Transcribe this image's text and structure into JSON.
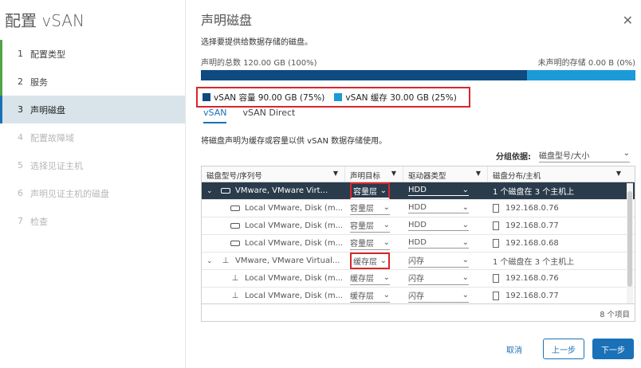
{
  "wizard": {
    "title": "配置 vSAN"
  },
  "steps": [
    {
      "num": "1",
      "label": "配置类型"
    },
    {
      "num": "2",
      "label": "服务"
    },
    {
      "num": "3",
      "label": "声明磁盘"
    },
    {
      "num": "4",
      "label": "配置故障域"
    },
    {
      "num": "5",
      "label": "选择见证主机"
    },
    {
      "num": "6",
      "label": "声明见证主机的磁盘"
    },
    {
      "num": "7",
      "label": "检查"
    }
  ],
  "page": {
    "title": "声明磁盘",
    "description": "选择要提供给数据存储的磁盘。",
    "claimed_total": "声明的总数 120.00 GB (100%)",
    "unclaimed": "未声明的存储 0.00 B (0%)",
    "capacity_fraction": 0.75,
    "legend": [
      {
        "label": "vSAN 容量 90.00 GB (75%)",
        "color": "#0f4a80"
      },
      {
        "label": "vSAN 缓存 30.00 GB (25%)",
        "color": "#1a9bd8"
      }
    ],
    "tabs": [
      "vSAN",
      "vSAN Direct"
    ],
    "instruction": "将磁盘声明为缓存或容量以供 vSAN 数据存储使用。",
    "group_by_label": "分组依据:",
    "group_by_value": "磁盘型号/大小"
  },
  "grid": {
    "headers": [
      "磁盘型号/序列号",
      "声明目标",
      "驱动器类型",
      "磁盘分布/主机"
    ],
    "rows": [
      {
        "name": "VMware, VMware Virt...",
        "target": "容量层",
        "drive": "HDD",
        "dist": "1 个磁盘在 3 个主机上"
      },
      {
        "name": "Local VMware, Disk (m...",
        "target": "容量层",
        "drive": "HDD",
        "dist": "192.168.0.76"
      },
      {
        "name": "Local VMware, Disk (m...",
        "target": "容量层",
        "drive": "HDD",
        "dist": "192.168.0.77"
      },
      {
        "name": "Local VMware, Disk (m...",
        "target": "容量层",
        "drive": "HDD",
        "dist": "192.168.0.68"
      },
      {
        "name": "VMware, VMware Virtual...",
        "target": "缓存层",
        "drive": "闪存",
        "dist": "1 个磁盘在 3 个主机上"
      },
      {
        "name": "Local VMware, Disk (m...",
        "target": "缓存层",
        "drive": "闪存",
        "dist": "192.168.0.76"
      },
      {
        "name": "Local VMware, Disk (m...",
        "target": "缓存层",
        "drive": "闪存",
        "dist": "192.168.0.77"
      }
    ],
    "footer": "8 个项目"
  },
  "buttons": {
    "cancel": "取消",
    "back": "上一步",
    "next": "下一步"
  },
  "icons": {
    "close": "close-icon",
    "filter": "filter-icon",
    "chevron": "chevron-down-icon"
  }
}
